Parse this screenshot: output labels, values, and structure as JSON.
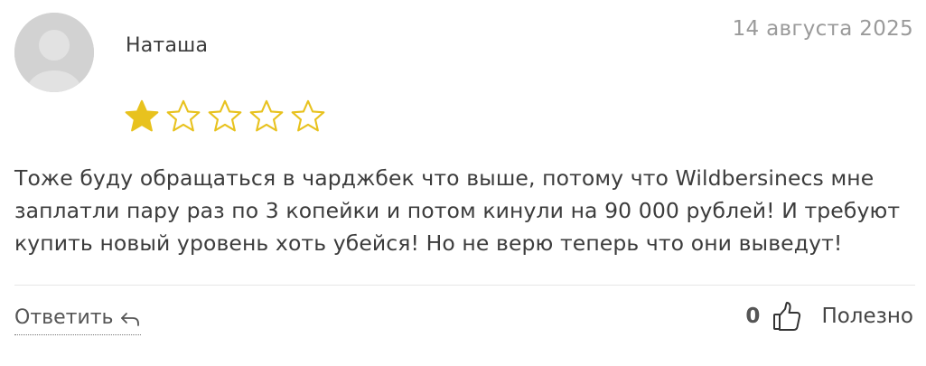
{
  "review": {
    "author": "Наташа",
    "date": "14 августа 2025",
    "rating": 1,
    "max_rating": 5,
    "text": "Тоже буду обращаться в чарджбек что выше, потому что Wildbersinecs мне заплатли пару раз по 3 копейки и потом кинули на 90 000 рублей! И требуют купить новый уровень хоть убейся! Но не верю теперь что они выведут!"
  },
  "actions": {
    "reply_label": "Ответить",
    "reply_icon": "reply-arrow-icon",
    "useful_count": "0",
    "useful_icon": "thumbs-up-icon",
    "useful_label": "Полезно"
  },
  "colors": {
    "star_filled": "#E8C21E",
    "star_empty_outline": "#E8C21E",
    "avatar_bg": "#D2D2D2",
    "date_text": "#9A9A9A"
  }
}
